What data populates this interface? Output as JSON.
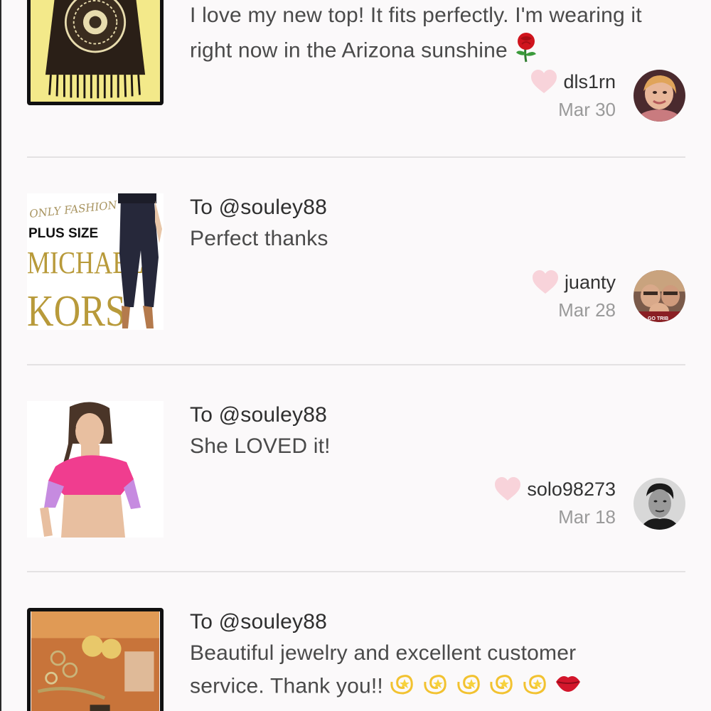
{
  "comments": [
    {
      "to": "",
      "message_line1": "I love my new top! It fits perfectly. I'm wearing it",
      "message_line2": "right now in the Arizona sunshine",
      "emoji": "rose-icon",
      "username": "dls1rn",
      "date": "Mar 30"
    },
    {
      "to": "To @souley88",
      "message": "Perfect thanks",
      "thumb_text": {
        "line1": "ONLY FASHION",
        "line2": "PLUS SIZE",
        "line3": "MICHAEL",
        "line4": "KORS"
      },
      "username": "juanty",
      "date": "Mar 28"
    },
    {
      "to": "To @souley88",
      "message": "She LOVED it!",
      "username": "solo98273",
      "date": "Mar 18"
    },
    {
      "to": "To @souley88",
      "message_line1": "Beautiful jewelry and excellent customer",
      "message_line2": "service. Thank you!!",
      "emoji": [
        "dizzy-star-icon",
        "dizzy-star-icon",
        "dizzy-star-icon",
        "dizzy-star-icon",
        "dizzy-star-icon",
        "kiss-lips-icon"
      ]
    }
  ],
  "colors": {
    "heart": "#f8d3da",
    "divider": "#e4e2e3",
    "date": "#9a9a9a",
    "background": "#fbf9fa"
  }
}
